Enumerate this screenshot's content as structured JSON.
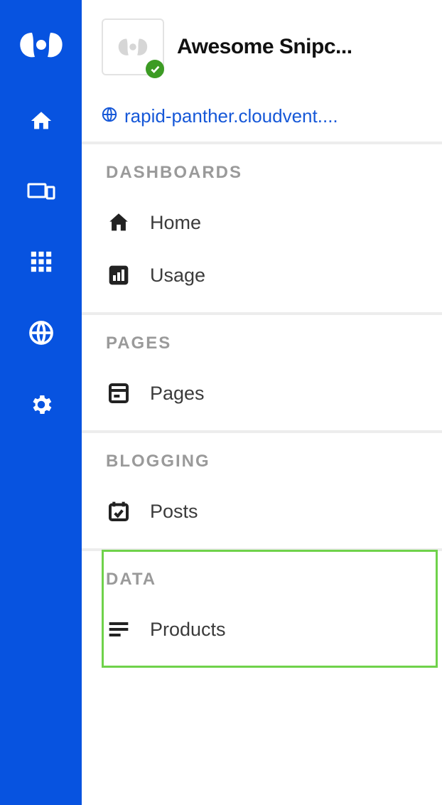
{
  "site": {
    "title": "Awesome Snipc...",
    "url_display": "rapid-panther.cloudvent...."
  },
  "rail": {
    "items": [
      {
        "name": "home-icon"
      },
      {
        "name": "devices-icon"
      },
      {
        "name": "apps-grid-icon"
      },
      {
        "name": "globe-icon"
      },
      {
        "name": "settings-gear-icon"
      }
    ]
  },
  "sections": [
    {
      "title": "DASHBOARDS",
      "items": [
        {
          "icon": "home",
          "label": "Home"
        },
        {
          "icon": "chart",
          "label": "Usage"
        }
      ]
    },
    {
      "title": "PAGES",
      "items": [
        {
          "icon": "page",
          "label": "Pages"
        }
      ]
    },
    {
      "title": "BLOGGING",
      "items": [
        {
          "icon": "calendar-check",
          "label": "Posts"
        }
      ]
    },
    {
      "title": "DATA",
      "items": [
        {
          "icon": "list",
          "label": "Products"
        }
      ]
    }
  ]
}
